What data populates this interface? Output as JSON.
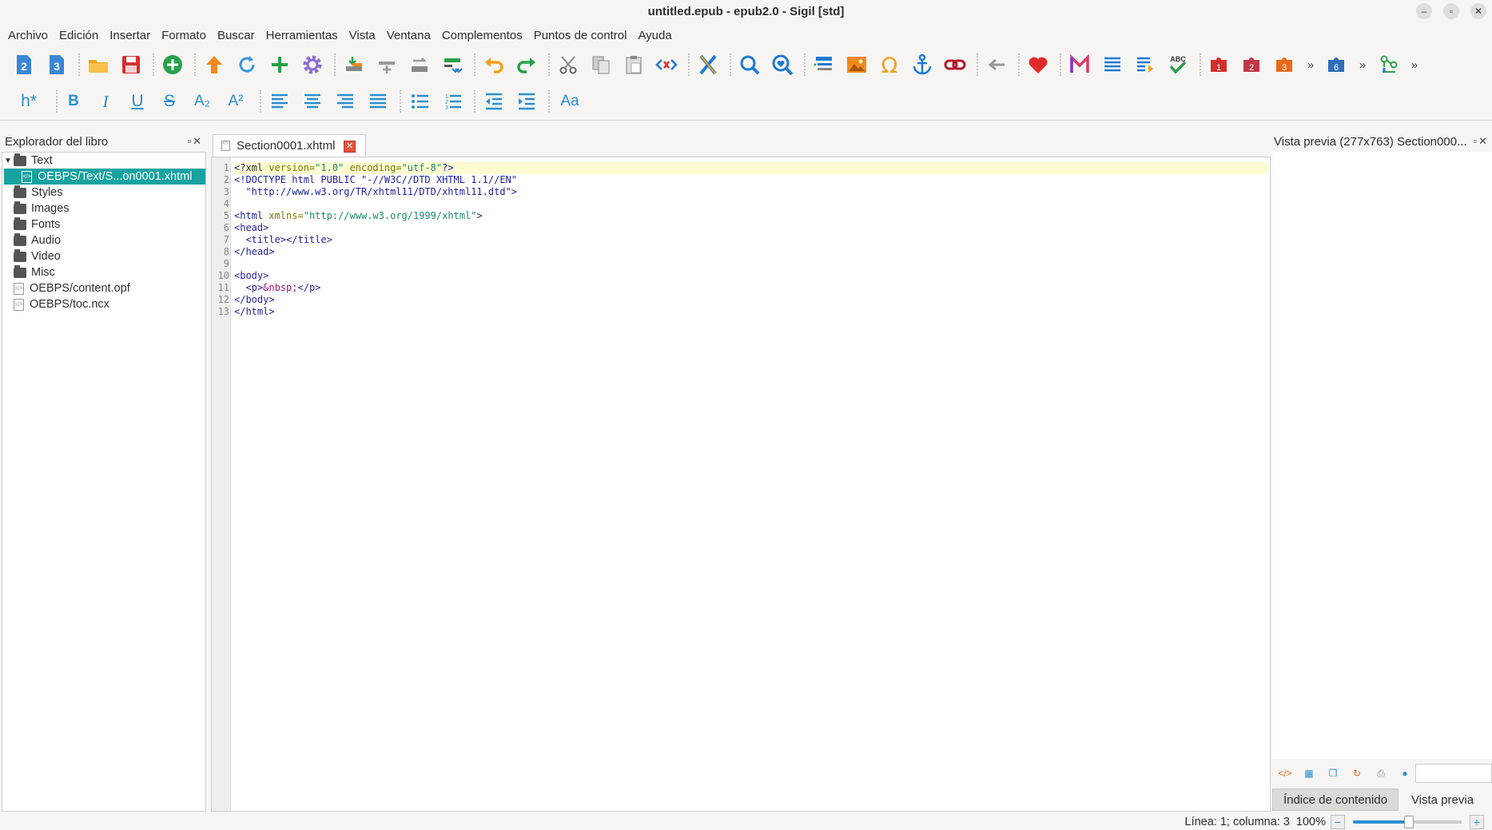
{
  "window": {
    "title": "untitled.epub - epub2.0 - Sigil [std]"
  },
  "menu": [
    "Archivo",
    "Edición",
    "Insertar",
    "Formato",
    "Buscar",
    "Herramientas",
    "Vista",
    "Ventana",
    "Complementos",
    "Puntos de control",
    "Ayuda"
  ],
  "toolbar_main": {
    "icons": [
      "epub2-icon",
      "epub3-icon",
      "open-folder-icon",
      "save-icon",
      "add-file-icon",
      "upload-icon",
      "refresh-icon",
      "add-existing-icon",
      "settings-gear-icon",
      "insert-file-icon",
      "split-icon",
      "merge-icon",
      "split-marker-icon",
      "undo-icon",
      "redo-icon",
      "cut-icon",
      "copy-icon",
      "paste-icon",
      "code-tags-icon",
      "close-x-icon",
      "find-icon",
      "find-heart-icon",
      "toc-icon",
      "image-icon",
      "omega-icon",
      "anchor-icon",
      "link-icon",
      "back-arrow-icon",
      "heart-icon",
      "m-icon",
      "list-icon",
      "list-edit-icon",
      "spellcheck-icon",
      "plugin1-icon",
      "plugin2-icon",
      "plugin3-icon",
      "plugin6-icon",
      "checkpoint-icon"
    ],
    "more": "»"
  },
  "toolbar_format": {
    "heading": "h*",
    "bold": "B",
    "italic": "I",
    "underline": "U",
    "strike": "S",
    "subscript": "A₂",
    "superscript": "A²",
    "case": "Aa"
  },
  "book_browser": {
    "title": "Explorador del libro",
    "items": [
      {
        "label": "Text",
        "type": "folder"
      },
      {
        "label": "OEBPS/Text/S...on0001.xhtml",
        "type": "file"
      },
      {
        "label": "Styles",
        "type": "folder"
      },
      {
        "label": "Images",
        "type": "folder"
      },
      {
        "label": "Fonts",
        "type": "folder"
      },
      {
        "label": "Audio",
        "type": "folder"
      },
      {
        "label": "Video",
        "type": "folder"
      },
      {
        "label": "Misc",
        "type": "folder"
      },
      {
        "label": "OEBPS/content.opf",
        "type": "file"
      },
      {
        "label": "OEBPS/toc.ncx",
        "type": "file"
      }
    ]
  },
  "editor": {
    "tab_label": "Section0001.xhtml",
    "line_numbers": [
      "1",
      "2",
      "3",
      "4",
      "5",
      "6",
      "7",
      "8",
      "9",
      "10",
      "11",
      "12",
      "13"
    ]
  },
  "preview": {
    "title": "Vista previa (277x763) Section000...",
    "tabs": [
      "Índice de contenido",
      "Vista previa"
    ]
  },
  "status": {
    "position": "Línea: 1; columna: 3",
    "zoom": "100%",
    "zoom_level": 0.5
  },
  "colors": {
    "accent": "#17a2a0",
    "blue": "#2a8fd0",
    "red": "#d42f2f"
  }
}
